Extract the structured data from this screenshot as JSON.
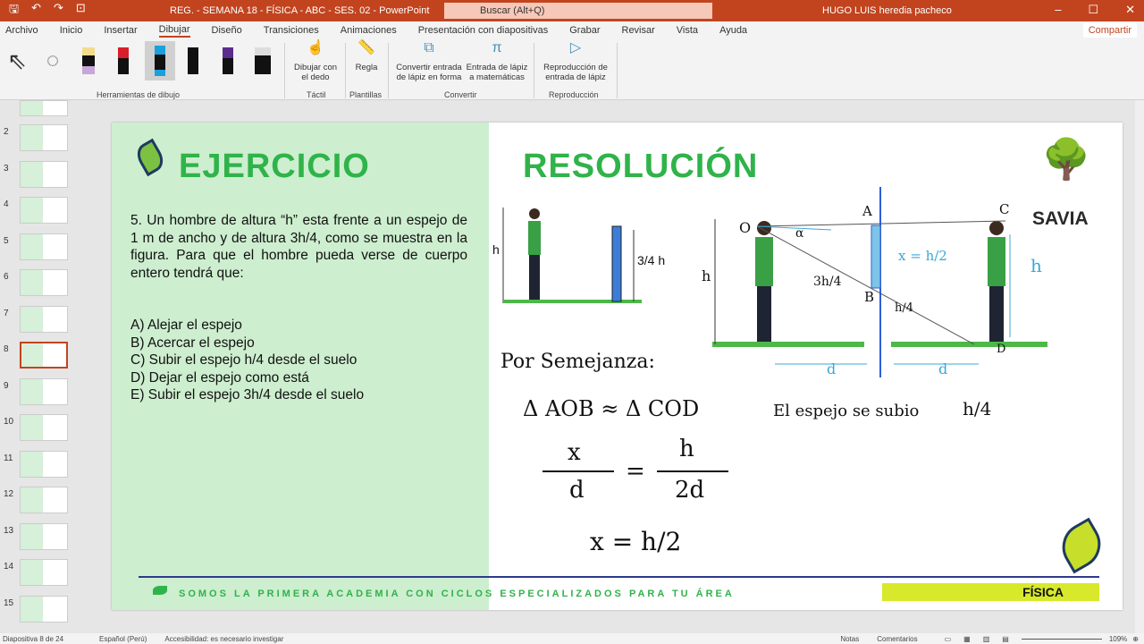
{
  "titlebar": {
    "title": "REG. - SEMANA 18 - FÍSICA - ABC - SES. 02  -  PowerPoint",
    "search_placeholder": "Buscar (Alt+Q)",
    "user": "HUGO LUIS heredia pacheco"
  },
  "menu": [
    "Archivo",
    "Inicio",
    "Insertar",
    "Dibujar",
    "Diseño",
    "Transiciones",
    "Animaciones",
    "Presentación con diapositivas",
    "Grabar",
    "Revisar",
    "Vista",
    "Ayuda"
  ],
  "share": "Compartir",
  "ribbon": {
    "draw_finger": "Dibujar con el dedo",
    "ruler": "Regla",
    "convert_shape": "Convertir entrada de lápiz en forma",
    "ink_math": "Entrada de lápiz a matemáticas",
    "replay": "Reproducción de entrada de lápiz",
    "groups": {
      "tools": "Herramientas de dibujo",
      "touch": "Táctil",
      "stencils": "Plantillas",
      "convert": "Convertir",
      "replay": "Reproducción"
    }
  },
  "thumbs": [
    "2",
    "3",
    "4",
    "5",
    "6",
    "7",
    "8",
    "9",
    "10",
    "11",
    "12",
    "13",
    "14",
    "15"
  ],
  "slide": {
    "title_left": "EJERCICIO",
    "title_right": "RESOLUCIÓN",
    "problem": "5. Un hombre de altura “h” esta frente a un espejo de 1 m de ancho y de altura 3h/4, como se muestra en la figura. Para que el hombre pueda verse de cuerpo entero tendrá que:",
    "options": [
      "A) Alejar el espejo",
      "B) Acercar el espejo",
      "C) Subir el espejo h/4 desde el suelo",
      "D) Dejar el espejo como está",
      "E) Subir el espejo 3h/4 desde el suelo"
    ],
    "fig_h": "h",
    "fig_mirror": "3/4 h",
    "hand": {
      "semejanza": "Por Semejanza:",
      "triangles": "Δ AOB ≈ Δ COD",
      "x": "x",
      "d": "d",
      "h": "h",
      "2d": "2d",
      "result": "x = h/2",
      "conclusion": "El espejo se subio",
      "h4": "h/4"
    },
    "diagram": {
      "O": "O",
      "A": "A",
      "B": "B",
      "C": "C",
      "D": "D",
      "alpha": "α",
      "h": "h",
      "three_h4": "3h/4",
      "x_eq": "x = h/2",
      "h4": "h/4",
      "d": "d"
    },
    "logo": "SAVIA",
    "footer": "SOMOS LA PRIMERA ACADEMIA CON CICLOS ESPECIALIZADOS PARA TU ÁREA",
    "subject": "FÍSICA"
  },
  "status": {
    "slide": "Diapositiva 8 de 24",
    "lang": "Español (Perú)",
    "access": "Accesibilidad: es necesario investigar",
    "notes": "Notas",
    "comments": "Comentarios",
    "zoom": "109%"
  }
}
